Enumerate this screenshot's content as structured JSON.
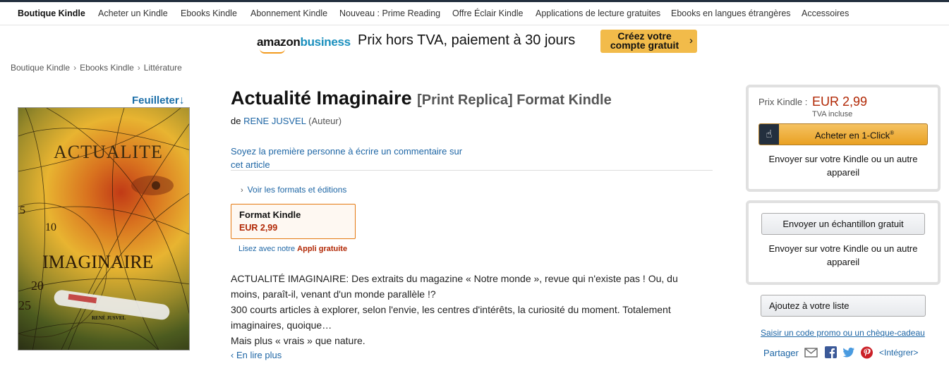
{
  "subnav": {
    "items": [
      "Boutique Kindle",
      "Acheter un Kindle",
      "Ebooks Kindle",
      "Abonnement Kindle",
      "Nouveau : Prime Reading",
      "Offre Éclair Kindle",
      "Applications de lecture gratuites",
      "Ebooks en langues étrangères",
      "Accessoires"
    ]
  },
  "banner": {
    "logo_amazon": "amazon",
    "logo_business": "business",
    "text": "Prix hors TVA, paiement à 30 jours",
    "button_line1": "Créez votre",
    "button_line2": "compte gratuit",
    "button_chevron": "›"
  },
  "breadcrumb": {
    "items": [
      "Boutique Kindle",
      "Ebooks Kindle",
      "Littérature"
    ],
    "separator": "›"
  },
  "cover": {
    "look_inside": "Feuilleter",
    "title_top": "ACTUALITE",
    "title_bottom": "IMAGINAIRE",
    "author": "RENÉ JUSVEL",
    "numbers": [
      "10",
      "20",
      "25",
      "5"
    ]
  },
  "product": {
    "title": "Actualité Imaginaire",
    "binding": "[Print Replica] Format Kindle",
    "by": "de",
    "author": "RENE JUSVEL",
    "author_role": "(Auteur)",
    "review_link": "Soyez la première personne à écrire un commentaire sur cet article",
    "formats_link": "Voir les formats et éditions",
    "format_name": "Format Kindle",
    "format_price": "EUR 2,99",
    "app_line_prefix": "Lisez avec notre",
    "app_line_strong": "Appli gratuite",
    "description": [
      "ACTUALITÉ IMAGINAIRE: Des extraits du magazine « Notre monde », revue qui n'existe pas ! Ou, du moins, paraît-il, venant d'un monde parallèle !?",
      "300 courts articles à explorer, selon l'envie, les centres d'intérêts, la curiosité du moment. Totalement imaginaires, quoique…",
      "Mais plus « vrais » que nature."
    ],
    "read_more": "‹ En lire plus"
  },
  "buybox": {
    "price_label": "Prix Kindle :",
    "price": "EUR 2,99",
    "tva": "TVA incluse",
    "oneclick_label": "Acheter en 1-Click",
    "oneclick_mark": "®",
    "send_to": "Envoyer sur votre Kindle ou un autre appareil"
  },
  "sample": {
    "button": "Envoyer un échantillon gratuit",
    "send_to": "Envoyer sur votre Kindle ou un autre appareil"
  },
  "wishlist": {
    "button": "Ajoutez à votre liste"
  },
  "promo": {
    "link": "Saisir un code promo ou un chèque-cadeau"
  },
  "share": {
    "label": "Partager",
    "icons": [
      "mail-icon",
      "facebook-icon",
      "twitter-icon",
      "pinterest-icon"
    ],
    "embed": "<Intégrer>"
  },
  "colors": {
    "link": "#1e66a5",
    "price": "#b12704",
    "accent_orange": "#e47911",
    "banner_button": "#f2bb4a",
    "nav_dark": "#232f3e"
  }
}
